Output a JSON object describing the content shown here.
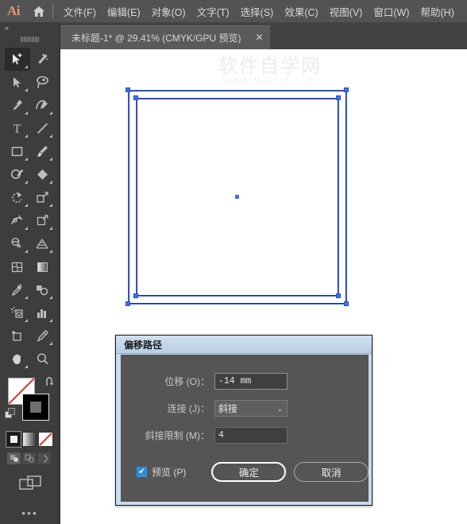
{
  "app": {
    "logo_text": "Ai",
    "home_icon": "home-icon"
  },
  "menubar": {
    "items": [
      {
        "label": "文件(F)",
        "name": "menu-file"
      },
      {
        "label": "编辑(E)",
        "name": "menu-edit"
      },
      {
        "label": "对象(O)",
        "name": "menu-object"
      },
      {
        "label": "文字(T)",
        "name": "menu-type"
      },
      {
        "label": "选择(S)",
        "name": "menu-select"
      },
      {
        "label": "效果(C)",
        "name": "menu-effect"
      },
      {
        "label": "视图(V)",
        "name": "menu-view"
      },
      {
        "label": "窗口(W)",
        "name": "menu-window"
      },
      {
        "label": "帮助(H)",
        "name": "menu-help"
      }
    ]
  },
  "tab": {
    "title": "未标题-1* @ 29.41% (CMYK/GPU 预览)",
    "close_label": "✕"
  },
  "toolpanel": {
    "collapse_label": "«",
    "tools": [
      {
        "name": "selection-plus-tool",
        "active": true
      },
      {
        "name": "magic-wand-tool",
        "active": false
      },
      {
        "name": "direct-selection-tool",
        "active": false
      },
      {
        "name": "lasso-tool",
        "active": false
      },
      {
        "name": "pen-tool",
        "active": false
      },
      {
        "name": "curvature-tool",
        "active": false
      },
      {
        "name": "type-tool",
        "active": false
      },
      {
        "name": "line-segment-tool",
        "active": false
      },
      {
        "name": "rectangle-tool",
        "active": false
      },
      {
        "name": "paintbrush-tool",
        "active": false
      },
      {
        "name": "shaper-tool",
        "active": false
      },
      {
        "name": "eraser-tool",
        "active": false
      },
      {
        "name": "rotate-tool",
        "active": false
      },
      {
        "name": "scale-tool",
        "active": false
      },
      {
        "name": "width-tool",
        "active": false
      },
      {
        "name": "free-transform-tool",
        "active": false
      },
      {
        "name": "shape-builder-tool",
        "active": false
      },
      {
        "name": "perspective-grid-tool",
        "active": false
      },
      {
        "name": "mesh-tool",
        "active": false
      },
      {
        "name": "gradient-tool",
        "active": false
      },
      {
        "name": "eyedropper-tool",
        "active": false
      },
      {
        "name": "blend-tool",
        "active": false
      },
      {
        "name": "symbol-sprayer-tool",
        "active": false
      },
      {
        "name": "column-graph-tool",
        "active": false
      },
      {
        "name": "artboard-tool",
        "active": false
      },
      {
        "name": "slice-tool",
        "active": false
      },
      {
        "name": "hand-tool",
        "active": false
      },
      {
        "name": "zoom-tool",
        "active": false
      }
    ],
    "swatch": {
      "fill_color": "#ffffff",
      "fill_is_none": true,
      "stroke_color": "#000000",
      "swap_icon": "swap-fill-stroke-icon",
      "default_icon": "default-fill-stroke-icon"
    },
    "modes": [
      {
        "name": "color-mode-button",
        "selected": true
      },
      {
        "name": "gradient-mode-button",
        "selected": false
      },
      {
        "name": "none-mode-button",
        "selected": false
      }
    ],
    "draw_modes": [
      {
        "name": "draw-normal-button",
        "selected": true
      },
      {
        "name": "draw-behind-button",
        "selected": false
      },
      {
        "name": "draw-inside-button",
        "selected": false
      }
    ],
    "screen_mode": "change-screen-mode-button",
    "more_tools": "edit-toolbar-button",
    "more_tools_label": "•••"
  },
  "canvas": {
    "watermark_cn": "软件自学网",
    "watermark_en": "WWW.RJZXW.COM",
    "selection_color": "#3d6ff0",
    "path_color": "#1f2b8f"
  },
  "dialog": {
    "title": "偏移路径",
    "fields": [
      {
        "label": "位移 (O)：",
        "value": "-14 mm",
        "name": "offset-value-input",
        "type": "text",
        "focused": true
      },
      {
        "label": "连接 (J)：",
        "value": "斜接",
        "name": "joins-select",
        "type": "select",
        "focused": false
      },
      {
        "label": "斜接限制 (M)：",
        "value": "4",
        "name": "miter-limit-input",
        "type": "text",
        "focused": false
      }
    ],
    "preview": {
      "label": "预览 (P)",
      "checked": true,
      "check_glyph": "✔",
      "accent": "#2a8fe0"
    },
    "ok_label": "确定",
    "cancel_label": "取消",
    "chevron": "⌄"
  }
}
